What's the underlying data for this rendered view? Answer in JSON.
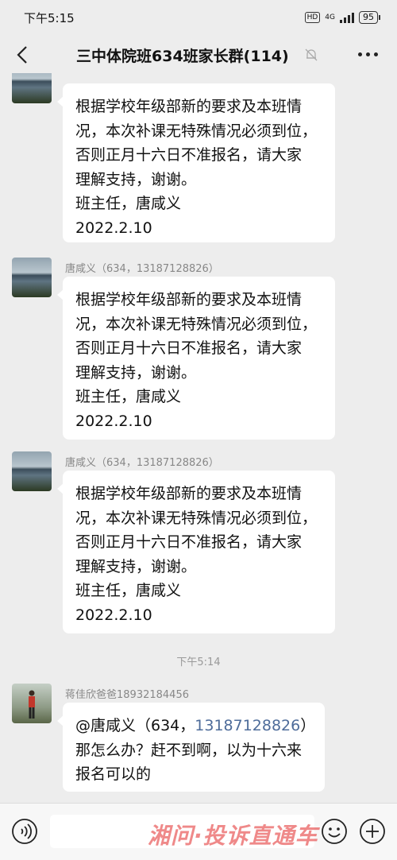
{
  "status_bar": {
    "time": "下午5:15",
    "hd": "HD",
    "network": "4G",
    "battery": "95"
  },
  "nav": {
    "title": "三中体院班634班家长群(114)"
  },
  "messages": [
    {
      "sender": "",
      "lines": [
        "根据学校年级部新的要求及本班情",
        "况，本次补课无特殊情况必须到位，",
        "否则正月十六日不准报名，请大家",
        "理解支持，谢谢。",
        "班主任，唐咸义",
        "2022.2.10"
      ]
    },
    {
      "sender": "唐咸义（634，13187128826）",
      "lines": [
        "根据学校年级部新的要求及本班情",
        "况，本次补课无特殊情况必须到位，",
        "否则正月十六日不准报名，请大家",
        "理解支持，谢谢。",
        "班主任，唐咸义",
        "2022.2.10"
      ]
    },
    {
      "sender": "唐咸义（634，13187128826）",
      "lines": [
        "根据学校年级部新的要求及本班情",
        "况，本次补课无特殊情况必须到位，",
        "否则正月十六日不准报名，请大家",
        "理解支持，谢谢。",
        "班主任，唐咸义",
        "2022.2.10"
      ]
    }
  ],
  "time_divider": "下午5:14",
  "last_message": {
    "sender": "蒋佳欣爸爸18932184456",
    "mention_prefix": "@唐咸义（634，",
    "mention_phone": "13187128826",
    "mention_suffix": "）",
    "line2": "那怎么办？赶不到啊，以为十六来",
    "line3": "报名可以的"
  },
  "watermark": "湘问·投诉直通车"
}
